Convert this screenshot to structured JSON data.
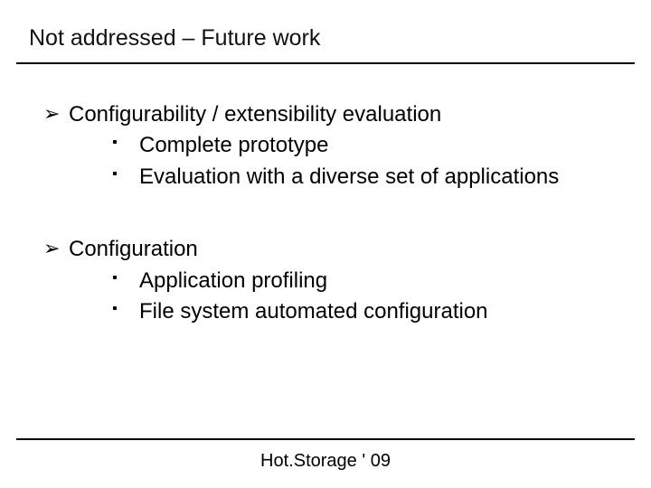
{
  "title": "Not addressed – Future work",
  "bullets": [
    {
      "text": "Configurability / extensibility evaluation",
      "sub": [
        "Complete prototype",
        "Evaluation with a diverse set of applications"
      ]
    },
    {
      "text": "Configuration",
      "sub": [
        "Application profiling",
        "File system automated configuration"
      ]
    }
  ],
  "footer": "Hot.Storage ' 09"
}
